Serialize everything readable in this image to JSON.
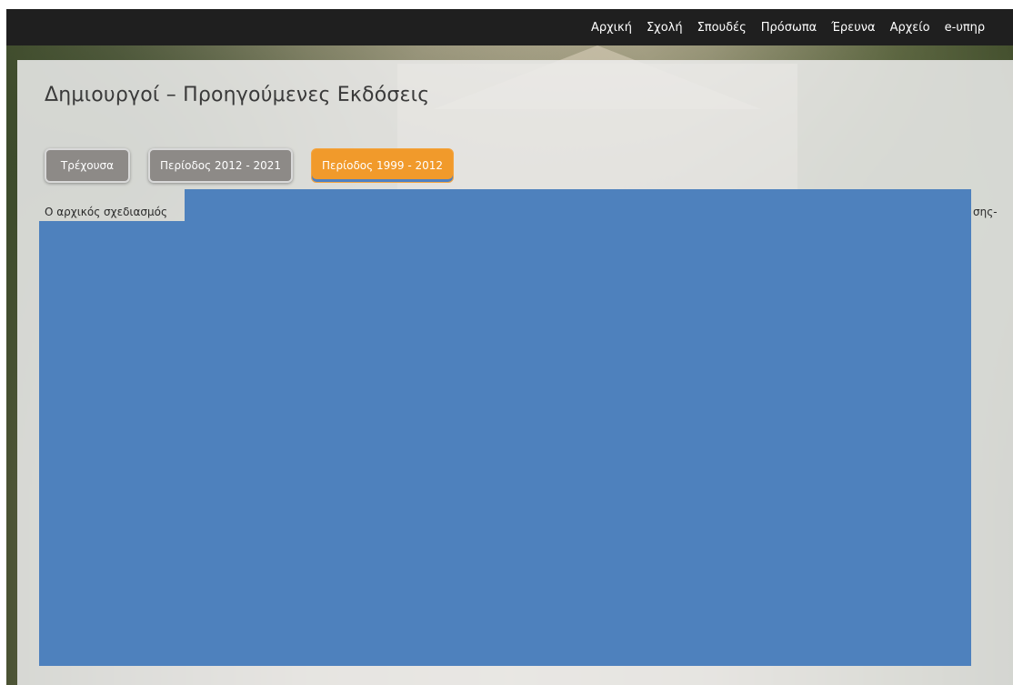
{
  "navigation": {
    "items": [
      "Αρχική",
      "Σχολή",
      "Σπουδές",
      "Πρόσωπα",
      "Έρευνα",
      "Αρχείο",
      "e-υπηρ"
    ]
  },
  "page": {
    "title": "Δημιουργοί – Προηγούμενες Εκδόσεις"
  },
  "tabs": [
    {
      "label": "Τρέχουσα",
      "state": "inactive"
    },
    {
      "label": "Περίοδος 2012 - 2021",
      "state": "inactive"
    },
    {
      "label": "Περίοδος 1999 - 2012",
      "state": "active"
    }
  ],
  "content": {
    "intro_visible": "Ο αρχικός σχεδιασμός",
    "intro_tail_visible": "σης-"
  },
  "colors": {
    "active_tab": "#f19a2b",
    "inactive_tab": "#8d8a87",
    "redaction": "#4e81bd",
    "navbar": "#1f1f1f"
  }
}
